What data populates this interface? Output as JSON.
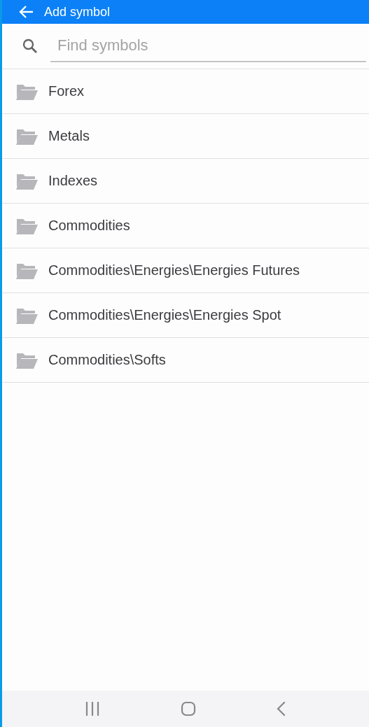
{
  "header": {
    "title": "Add symbol"
  },
  "search": {
    "placeholder": "Find symbols"
  },
  "folders": [
    {
      "label": "Forex"
    },
    {
      "label": "Metals"
    },
    {
      "label": "Indexes"
    },
    {
      "label": "Commodities"
    },
    {
      "label": "Commodities\\Energies\\Energies Futures"
    },
    {
      "label": "Commodities\\Energies\\Energies Spot"
    },
    {
      "label": "Commodities\\Softs"
    }
  ]
}
